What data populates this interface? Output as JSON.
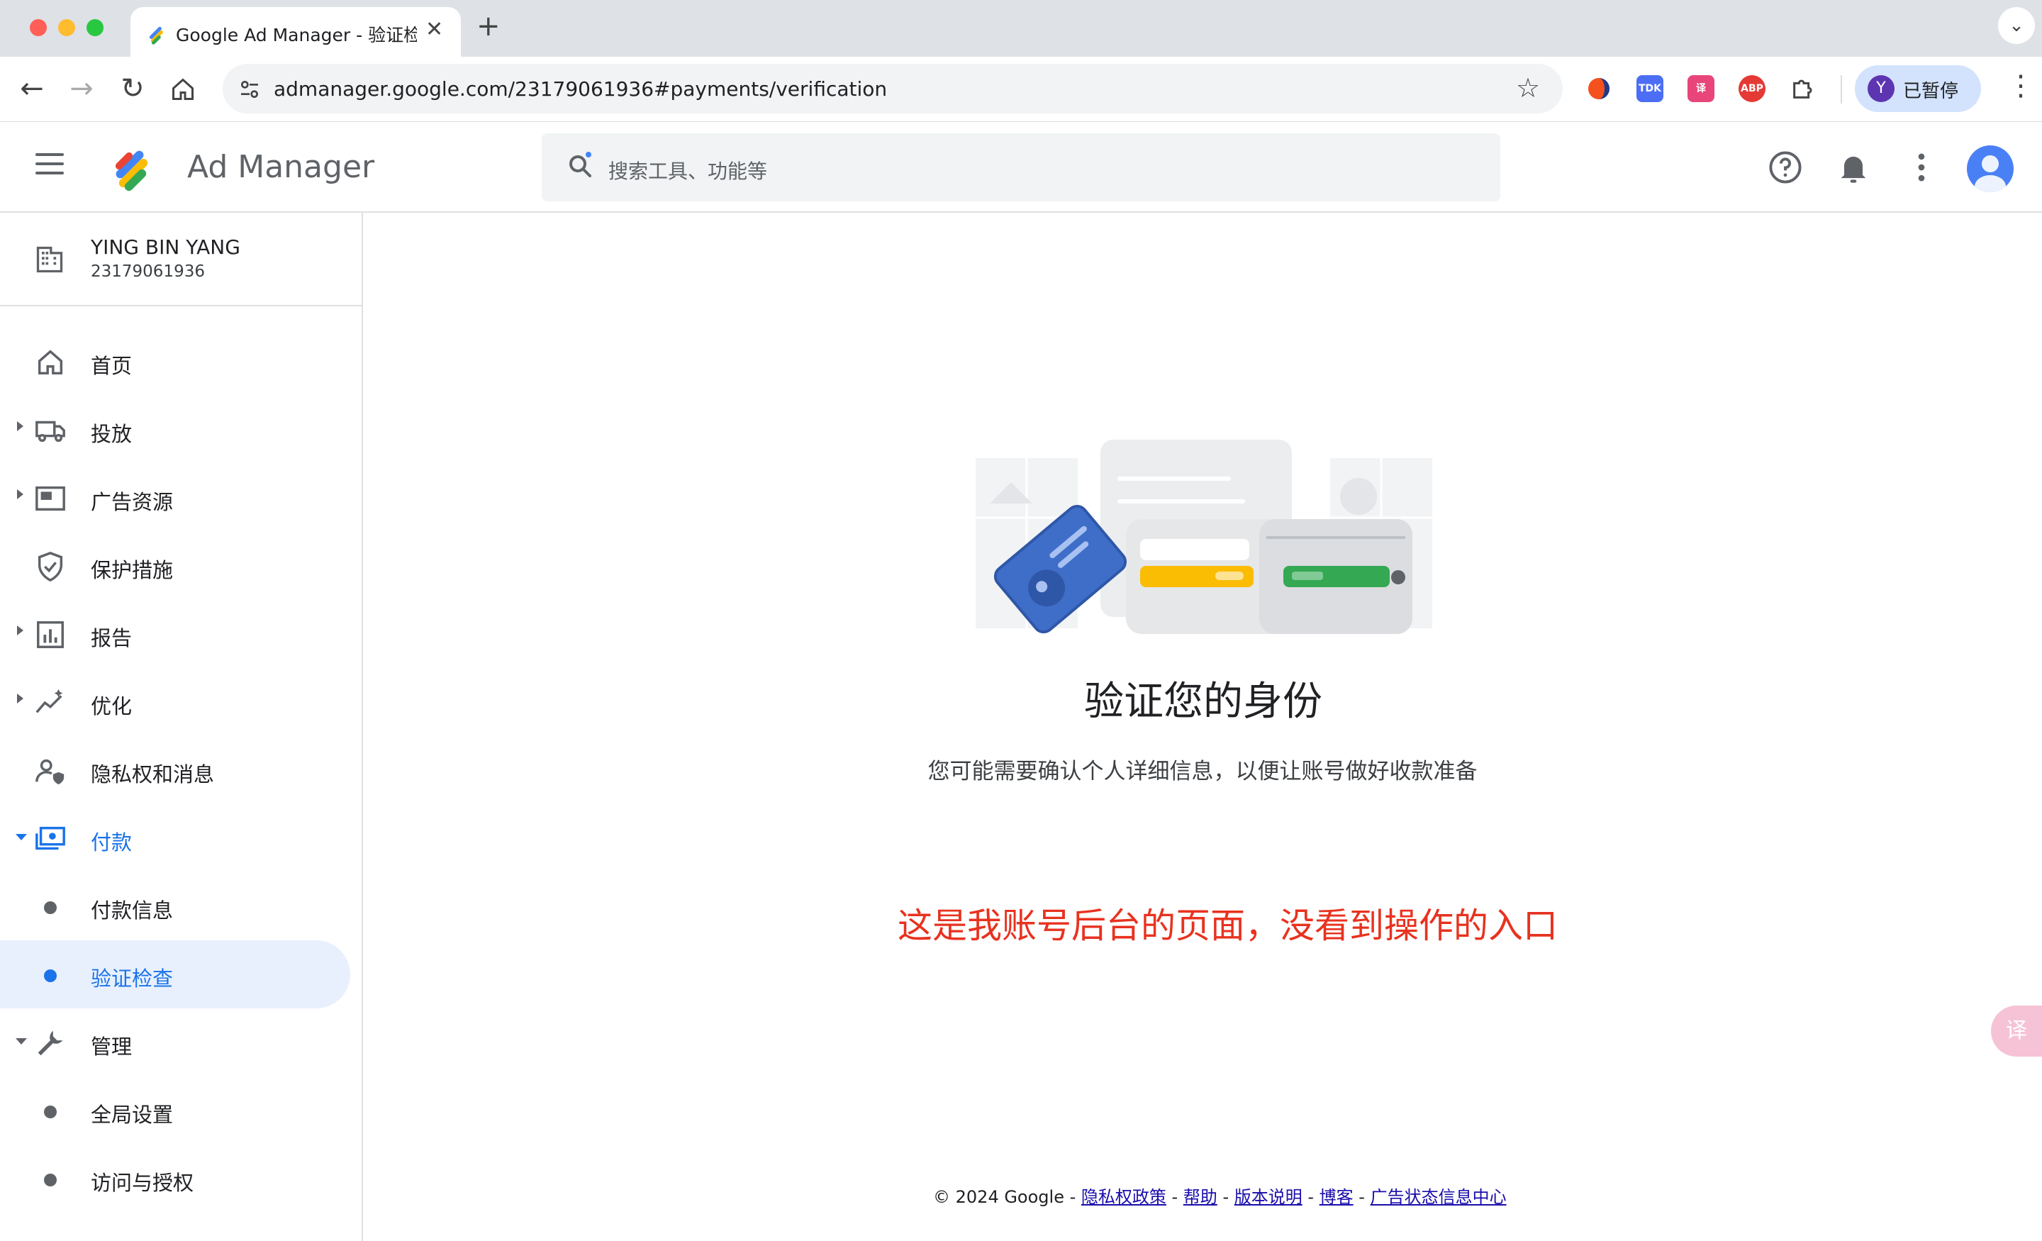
{
  "browser": {
    "tab_title": "Google Ad Manager - 验证检查",
    "new_tab_label": "+",
    "url": "admanager.google.com/23179061936#payments/verification",
    "profile_initial": "Y",
    "profile_label": "已暂停",
    "extensions": [
      {
        "name": "tdk-extension-icon",
        "label": "TDK",
        "color": "#4c6ef5"
      },
      {
        "name": "translate-extension-icon",
        "label": "译",
        "color": "#e8457a"
      },
      {
        "name": "adblock-extension-icon",
        "label": "ABP",
        "color": "#e53935"
      }
    ]
  },
  "header": {
    "app_name": "Ad Manager",
    "search_placeholder": "搜索工具、功能等"
  },
  "account": {
    "name": "YING BIN YANG",
    "id": "23179061936"
  },
  "sidebar": {
    "items": [
      {
        "label": "首页"
      },
      {
        "label": "投放"
      },
      {
        "label": "广告资源"
      },
      {
        "label": "保护措施"
      },
      {
        "label": "报告"
      },
      {
        "label": "优化"
      },
      {
        "label": "隐私权和消息"
      },
      {
        "label": "付款"
      },
      {
        "label": "付款信息"
      },
      {
        "label": "验证检查"
      },
      {
        "label": "管理"
      },
      {
        "label": "全局设置"
      },
      {
        "label": "访问与授权"
      }
    ]
  },
  "main": {
    "title": "验证您的身份",
    "description": "您可能需要确认个人详细信息，以便让账号做好收款准备",
    "annotation": "这是我账号后台的页面，没看到操作的入口"
  },
  "footer": {
    "copyright": "© 2024 Google - ",
    "links": [
      "隐私权政策",
      "帮助",
      "版本说明",
      "博客",
      "广告状态信息中心"
    ],
    "separator": " - "
  },
  "colors": {
    "accent": "#1a73e8",
    "annotation": "#e8321f",
    "active_bg": "#e8f0fe"
  }
}
